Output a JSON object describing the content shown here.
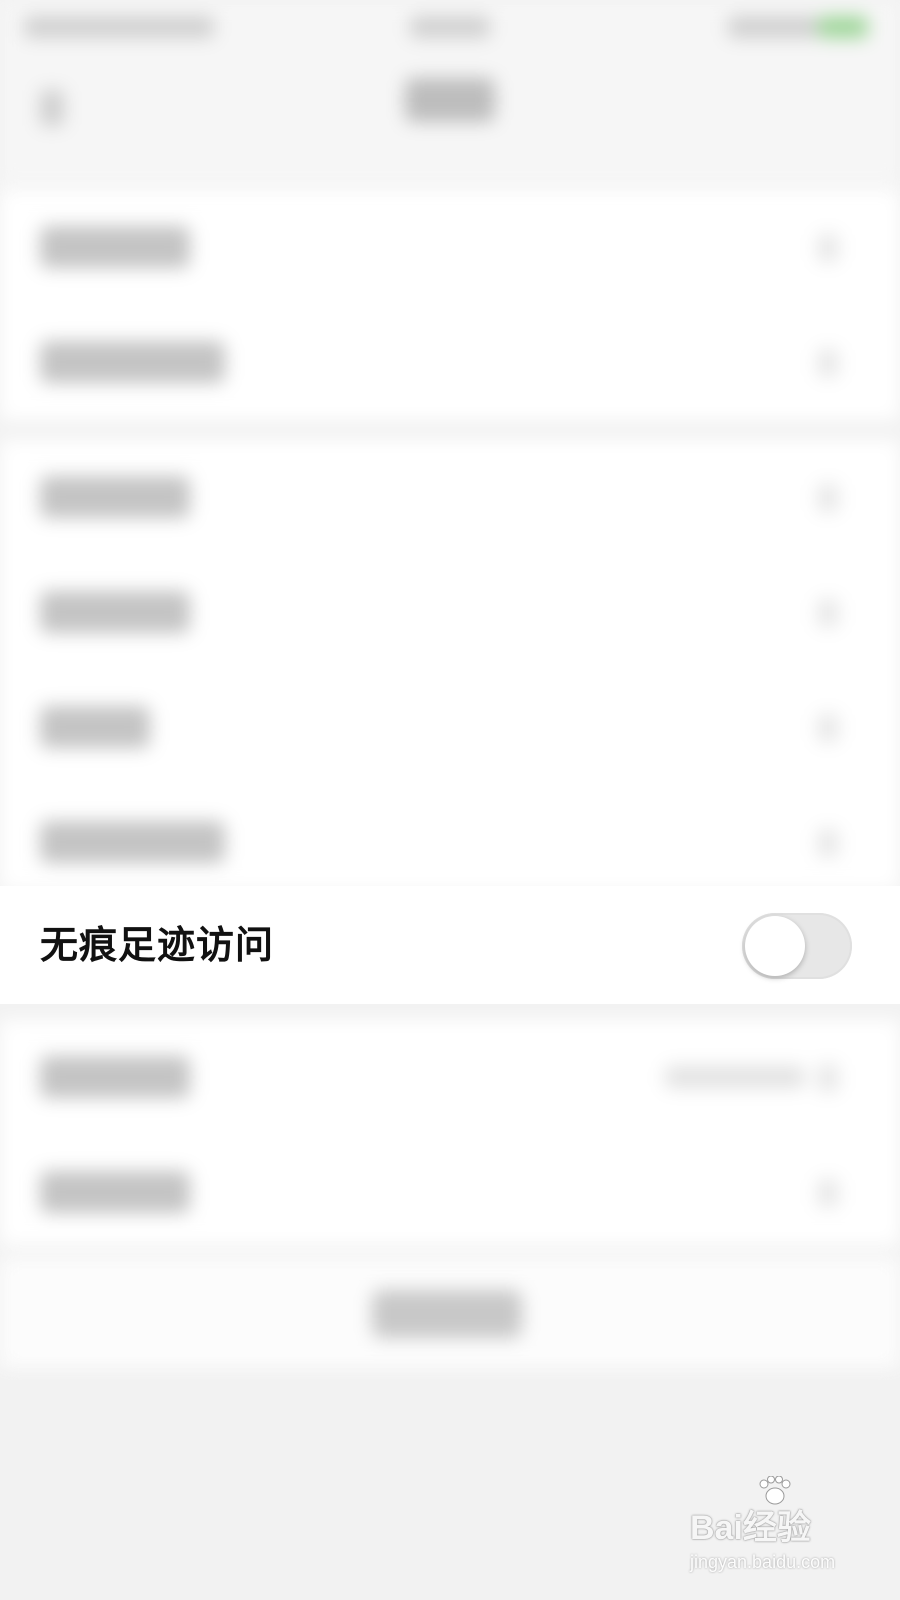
{
  "settings": {
    "focused_item": {
      "label": "无痕足迹访问",
      "toggle_on": false
    }
  },
  "watermark": {
    "brand": "Bai经验",
    "url": "jingyan.baidu.com"
  },
  "colors": {
    "toggle_off_track": "#e7e7e7",
    "toggle_knob": "#ffffff",
    "page_background": "#f2f2f2",
    "row_background": "#ffffff",
    "label_text": "#111111"
  },
  "icons": {
    "back": "chevron-left-icon",
    "row_disclosure": "chevron-right-icon",
    "watermark": "paw-icon"
  }
}
